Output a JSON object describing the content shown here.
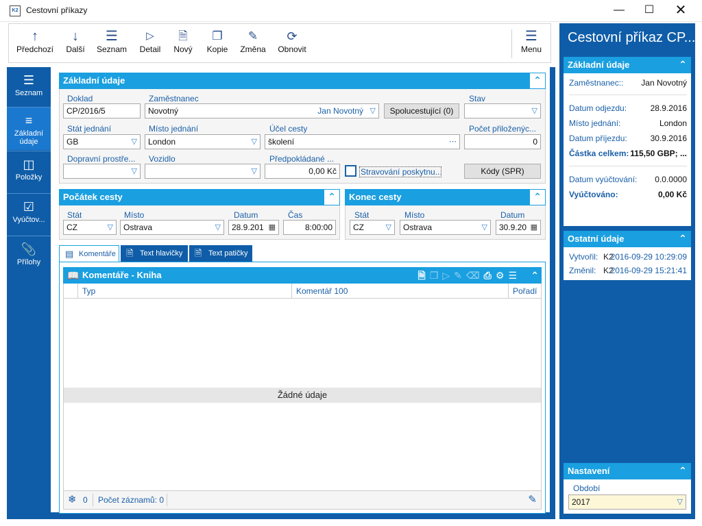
{
  "window": {
    "title": "Cestovní příkazy",
    "icon_text": "K2"
  },
  "toolbar": {
    "buttons": [
      {
        "label": "Předchozí",
        "icon": "arrow-up-icon"
      },
      {
        "label": "Další",
        "icon": "arrow-down-icon"
      },
      {
        "label": "Seznam",
        "icon": "list-icon"
      },
      {
        "label": "Detail",
        "icon": "play-icon"
      },
      {
        "label": "Nový",
        "icon": "new-document-icon"
      },
      {
        "label": "Kopie",
        "icon": "copy-icon"
      },
      {
        "label": "Změna",
        "icon": "pencil-icon"
      },
      {
        "label": "Obnovit",
        "icon": "refresh-icon"
      }
    ],
    "menu_label": "Menu"
  },
  "nav": {
    "items": [
      {
        "label": "Seznam",
        "icon": "list-icon"
      },
      {
        "label": "Základní údaje",
        "icon": "list-detail-icon",
        "active": true
      },
      {
        "label": "Položky",
        "icon": "box-icon"
      },
      {
        "label": "Vyúčtov...",
        "icon": "clipboard-check-icon"
      },
      {
        "label": "Přílohy",
        "icon": "paperclip-icon"
      }
    ]
  },
  "basic": {
    "title": "Základní údaje",
    "doklad_label": "Doklad",
    "doklad": "CP/2016/5",
    "zamestnanec_label": "Zaměstnanec",
    "zamestnanec": "Novotný",
    "zamestnanec_name": "Jan Novotný",
    "spolucestujici": "Spolucestující (0)",
    "stav_label": "Stav",
    "stav": "",
    "stat_label": "Stát jednání",
    "stat": "GB",
    "misto_label": "Místo jednání",
    "misto": "London",
    "ucel_label": "Účel cesty",
    "ucel": "školení",
    "prilohy_label": "Počet přiloženýc...",
    "prilohy": "0",
    "doprava_label": "Dopravní prostře...",
    "doprava": "",
    "vozidlo_label": "Vozidlo",
    "vozidlo": "",
    "predpoklad_label": "Předpokládané ...",
    "predpoklad": "0,00 Kč",
    "stravovani": "Stravování poskytnu...",
    "kody": "Kódy (SPR)"
  },
  "start": {
    "title": "Počátek cesty",
    "stat_label": "Stát",
    "stat": "CZ",
    "misto_label": "Místo",
    "misto": "Ostrava",
    "datum_label": "Datum",
    "datum": "28.9.201",
    "cas_label": "Čas",
    "cas": "8:00:00"
  },
  "end": {
    "title": "Konec cesty",
    "stat_label": "Stát",
    "stat": "CZ",
    "misto_label": "Místo",
    "misto": "Ostrava",
    "datum_label": "Datum",
    "datum": "30.9.20"
  },
  "tabs": [
    {
      "label": "Komentáře",
      "icon": "comment-icon",
      "active": true
    },
    {
      "label": "Text hlavičky",
      "icon": "document-icon"
    },
    {
      "label": "Text patičky",
      "icon": "document-icon"
    }
  ],
  "grid": {
    "title": "Komentáře - Kniha",
    "columns": [
      "Typ",
      "Komentář 100",
      "Pořadí"
    ],
    "empty": "Žádné údaje",
    "count_value": "0",
    "footer": "Počet záznamů: 0"
  },
  "right": {
    "title": "Cestovní příkaz CP...",
    "basic_title": "Základní údaje",
    "rows": [
      {
        "k": "Zaměstnanec::",
        "v": "Jan Novotný"
      },
      {
        "k": "Datum odjezdu:",
        "v": "28.9.2016"
      },
      {
        "k": "Místo jednání:",
        "v": "London"
      },
      {
        "k": "Datum příjezdu:",
        "v": "30.9.2016"
      },
      {
        "k": "Částka celkem:",
        "v": "115,50 GBP; ..."
      },
      {
        "k": "Datum vyúčtování:",
        "v": "0.0.0000"
      },
      {
        "k": "Vyúčtováno:",
        "v": "0,00 Kč"
      }
    ],
    "other_title": "Ostatní údaje",
    "created_label": "Vytvořil:",
    "created_user": "K2",
    "created_date": "2016-09-29 10:29:09",
    "changed_label": "Změnil:",
    "changed_user": "K2",
    "changed_date": "2016-09-29 15:21:41",
    "settings_title": "Nastavení",
    "period_label": "Období",
    "period": "2017"
  }
}
